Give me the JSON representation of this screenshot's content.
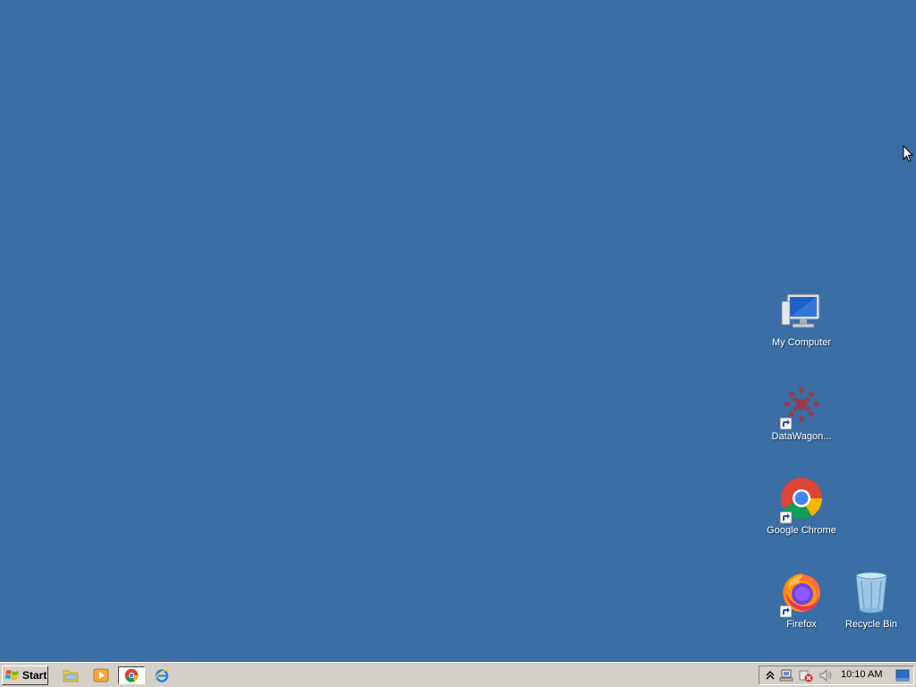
{
  "desktop": {
    "background_color": "#3a6ea5",
    "icons": [
      {
        "label": "My Computer",
        "icon": "my-computer-icon"
      },
      {
        "label": "DataWagon...",
        "icon": "datawagon-icon"
      },
      {
        "label": "Google Chrome",
        "icon": "chrome-icon"
      },
      {
        "label": "Firefox",
        "icon": "firefox-icon"
      },
      {
        "label": "Recycle Bin",
        "icon": "recycle-bin-icon"
      }
    ]
  },
  "taskbar": {
    "start_label": "Start",
    "quick_launch": [
      {
        "icon": "file-explorer-icon"
      },
      {
        "icon": "media-player-icon"
      },
      {
        "icon": "chrome-icon",
        "active": true
      },
      {
        "icon": "internet-explorer-icon"
      }
    ],
    "tray": {
      "icons": [
        "show-hidden-icons-icon",
        "network-icon",
        "action-center-icon",
        "volume-icon",
        "show-desktop-icon"
      ],
      "clock": "10:10 AM"
    }
  }
}
